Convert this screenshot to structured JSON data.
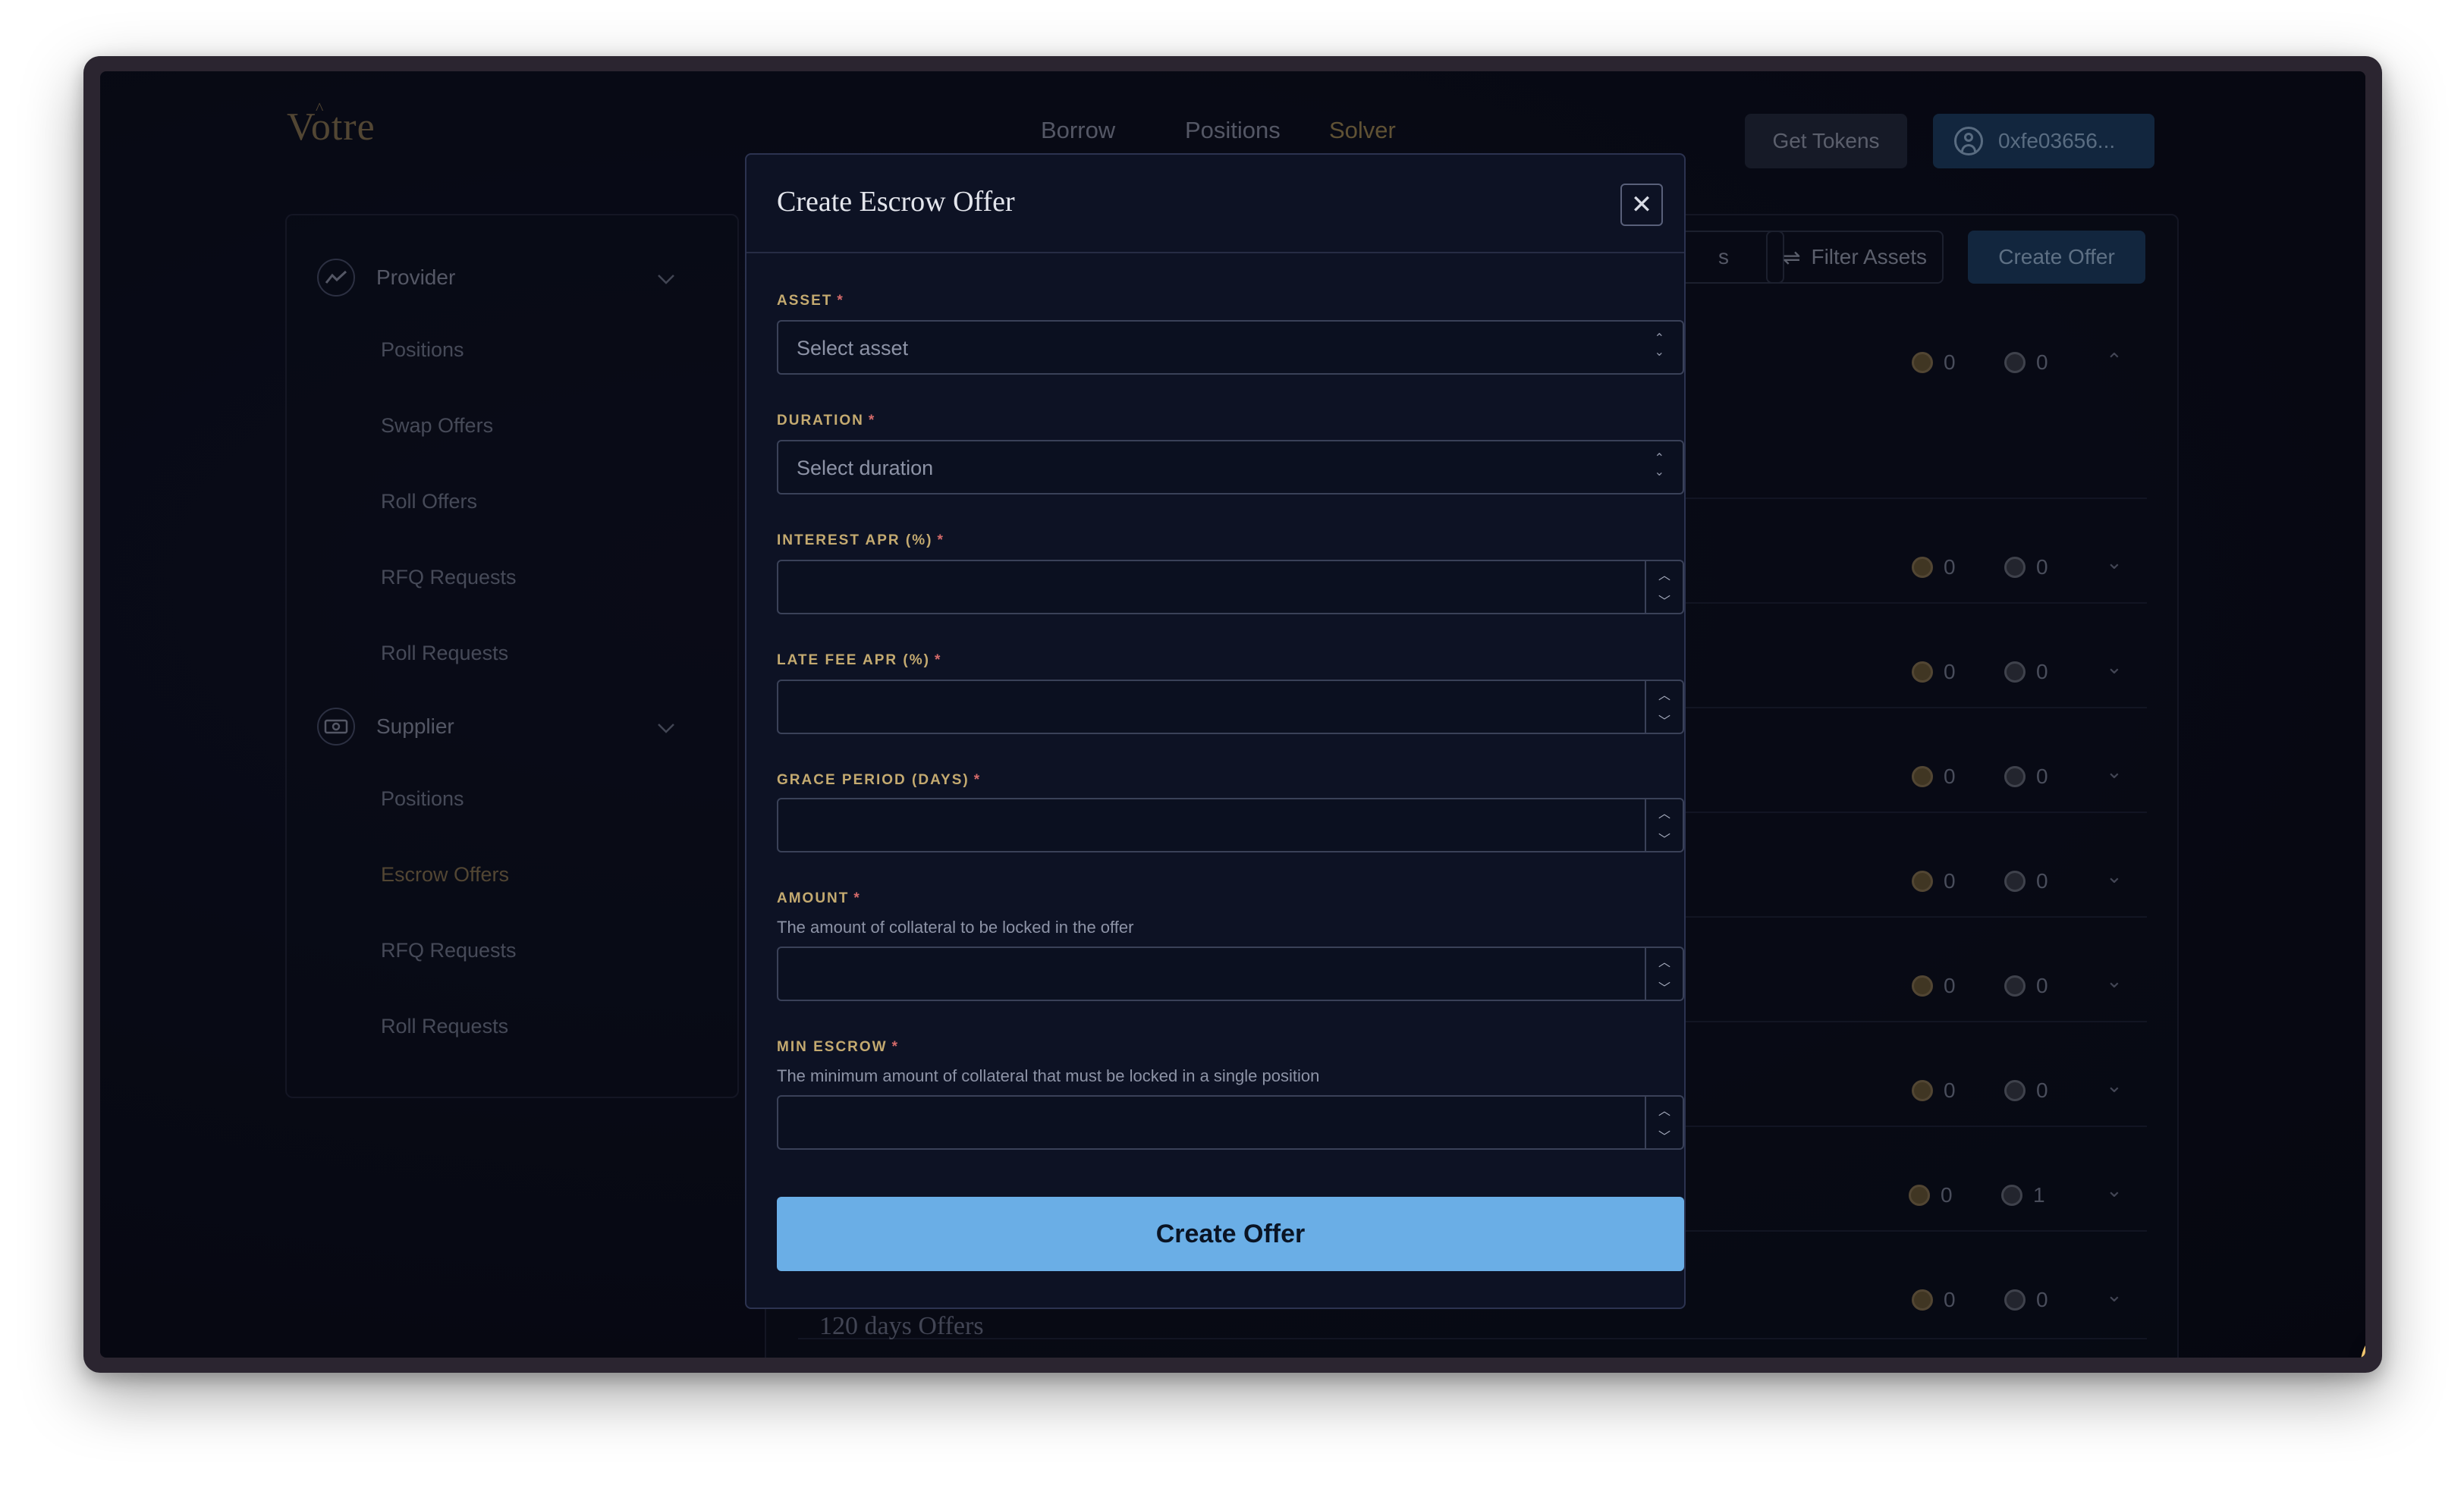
{
  "header": {
    "logo": "Votre",
    "nav": [
      {
        "label": "Borrow"
      },
      {
        "label": "Positions"
      },
      {
        "label": "Solver"
      }
    ],
    "get_tokens": "Get Tokens",
    "wallet": "0xfe03656..."
  },
  "sidebar": {
    "provider": {
      "label": "Provider",
      "icon": "chart-line-icon",
      "items": [
        "Positions",
        "Swap Offers",
        "Roll Offers",
        "RFQ Requests",
        "Roll Requests"
      ]
    },
    "supplier": {
      "label": "Supplier",
      "icon": "cash-icon",
      "items": [
        "Positions",
        "Escrow Offers",
        "RFQ Requests",
        "Roll Requests"
      ],
      "active_item": "Escrow Offers"
    }
  },
  "toolbar": {
    "partial_button": "s",
    "filter_label": "Filter Assets",
    "create_offer": "Create Offer"
  },
  "rows": [
    {
      "gold": "0",
      "grey": "0",
      "expanded": true
    },
    {
      "gold": "0",
      "grey": "0"
    },
    {
      "gold": "0",
      "grey": "0"
    },
    {
      "gold": "0",
      "grey": "0"
    },
    {
      "gold": "0",
      "grey": "0"
    },
    {
      "gold": "0",
      "grey": "0"
    },
    {
      "gold": "0",
      "grey": "0"
    },
    {
      "gold": "0",
      "grey": "1"
    },
    {
      "gold": "0",
      "grey": "0",
      "title": "120 days Offers"
    }
  ],
  "modal": {
    "title": "Create Escrow Offer",
    "fields": {
      "asset": {
        "label": "ASSET",
        "placeholder": "Select asset"
      },
      "duration": {
        "label": "DURATION",
        "placeholder": "Select duration"
      },
      "interest": {
        "label": "INTEREST APR (%)"
      },
      "late_fee": {
        "label": "LATE FEE APR (%)"
      },
      "grace": {
        "label": "GRACE PERIOD (DAYS)"
      },
      "amount": {
        "label": "AMOUNT",
        "help": "The amount of collateral to be locked in the offer"
      },
      "min_escrow": {
        "label": "MIN ESCROW",
        "help": "The minimum amount of collateral that must be locked in a single position"
      }
    },
    "required_mark": "*",
    "submit": "Create Offer"
  },
  "colors": {
    "accent_gold": "#c4aa70",
    "submit_blue": "#6aaee6",
    "modal_bg": "#0d1224"
  }
}
